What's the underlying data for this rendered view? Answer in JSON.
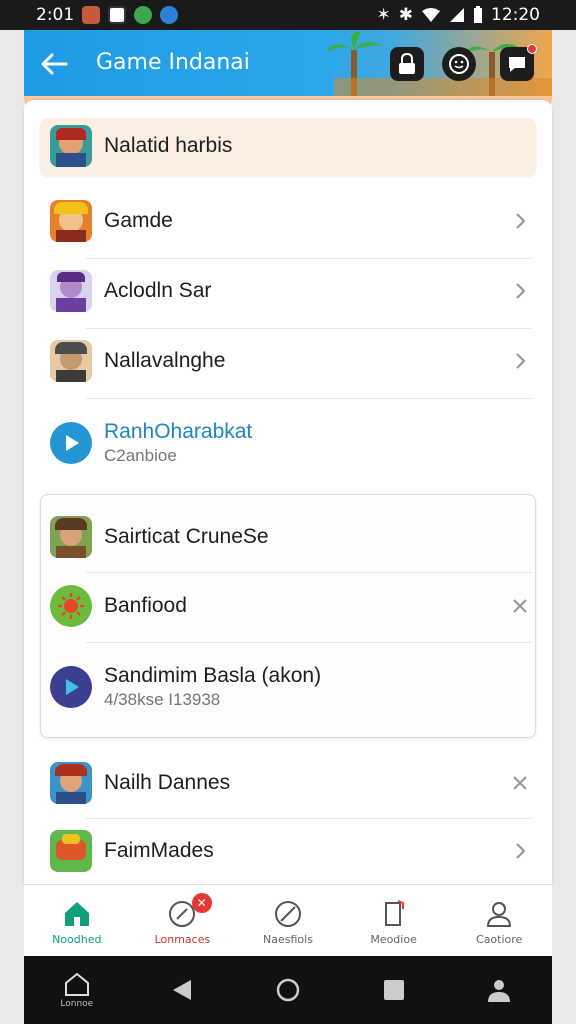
{
  "status_bar": {
    "time_left": "2:01",
    "time_right": "12:20"
  },
  "app_bar": {
    "title": "Game Indanai"
  },
  "list": {
    "highlight": {
      "label": "Nalatid harbis"
    },
    "items": [
      {
        "label": "Gamde"
      },
      {
        "label": "Aclodln Sar"
      },
      {
        "label": "Nallavalnghe"
      }
    ],
    "featured": {
      "title": "RanhOharabkat",
      "subtitle": "C2anbioe"
    }
  },
  "group": {
    "items": [
      {
        "label": "Sairticat CruneSe"
      },
      {
        "label": "Banfiood"
      },
      {
        "label": "Sandimim Basla (akon)",
        "subtitle": "4/38kse I13938"
      }
    ]
  },
  "after": {
    "items": [
      {
        "label": "Nailh Dannes"
      },
      {
        "label": "FaimMades"
      }
    ]
  },
  "bottom_nav": {
    "items": [
      {
        "label": "Noodhed"
      },
      {
        "label": "Lonmaces"
      },
      {
        "label": "Naesfiols"
      },
      {
        "label": "Meodioe"
      },
      {
        "label": "Caotiore"
      }
    ]
  },
  "system_nav": {
    "home_label": "Lonnoe"
  },
  "colors": {
    "accent": "#1f9be6",
    "active_nav": "#11a07a",
    "alert": "#e53935",
    "highlight_bg": "#fbeee3"
  }
}
